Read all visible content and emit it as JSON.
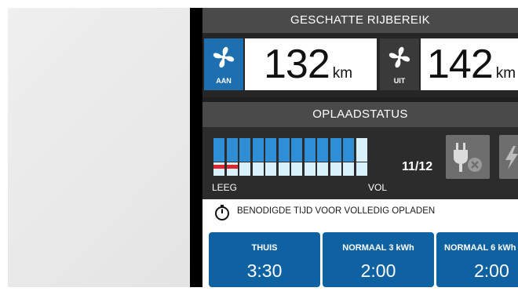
{
  "range": {
    "title": "GESCHATTE RIJBEREIK",
    "on": {
      "mode_label": "AAN",
      "value": "132",
      "unit": "km"
    },
    "off": {
      "mode_label": "UIT",
      "value": "142",
      "unit": "km"
    }
  },
  "charge": {
    "title": "OPLAADSTATUS",
    "level_segments": 11,
    "total_segments": 12,
    "count_text": "11/12",
    "empty_label": "LEEG",
    "full_label": "VOL"
  },
  "timer": {
    "text": "BENODIGDE TIJD VOOR VOLLEDIG OPLADEN"
  },
  "tiles": [
    {
      "label": "THUIS",
      "value": "3:30"
    },
    {
      "label": "NORMAAL  3 kWh",
      "value": "2:00"
    },
    {
      "label": "NORMAAL  6 kWh",
      "value": "2:00"
    }
  ],
  "colors": {
    "accent_blue": "#0f62a2",
    "fan_box_blue": "#1e6fb0",
    "battery_blue": "#2e8fd6",
    "battery_low": "#e0262a"
  },
  "icons": [
    "fan-icon",
    "plug-icon",
    "timer-icon",
    "lightning-icon"
  ]
}
